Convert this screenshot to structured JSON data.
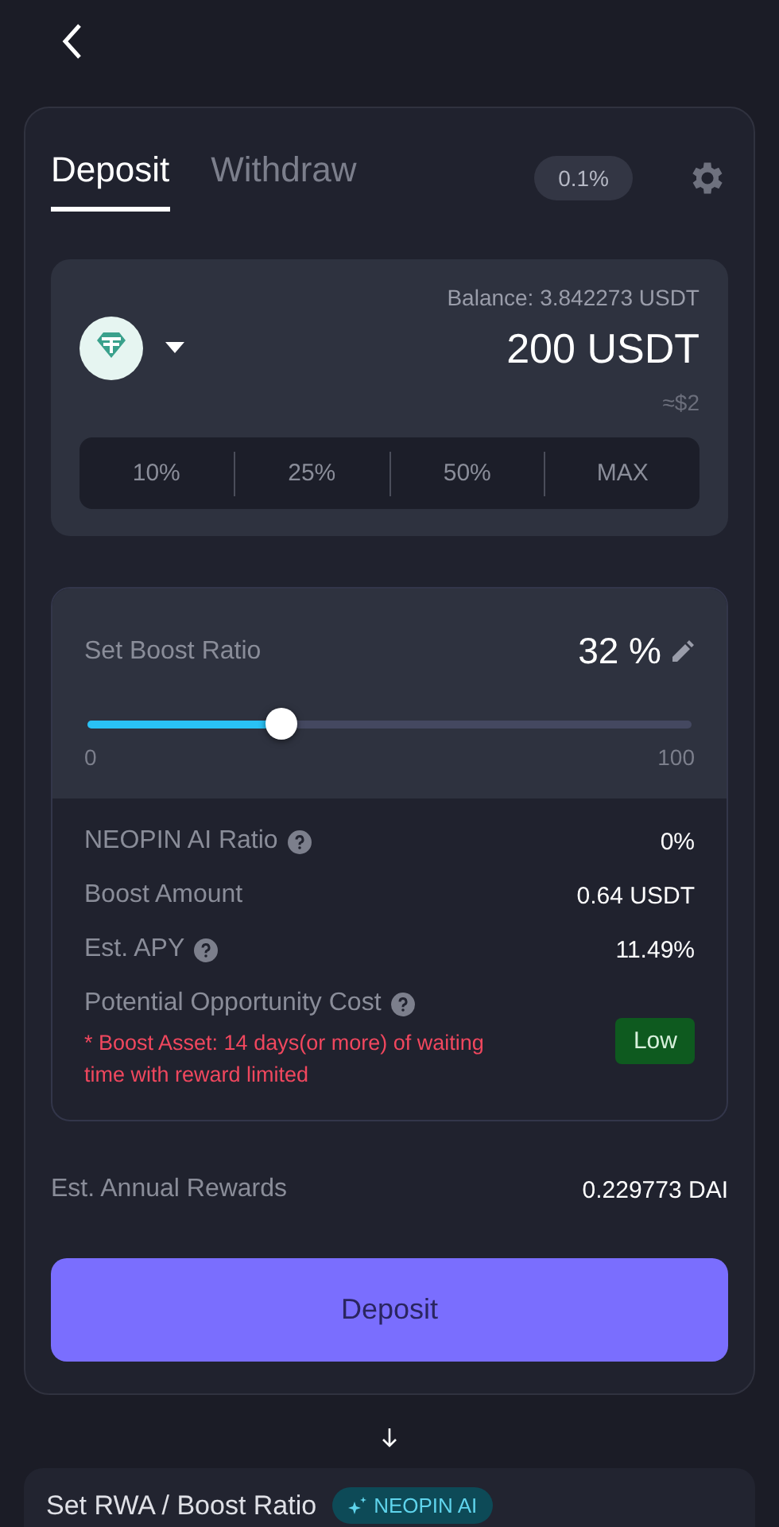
{
  "tabs": [
    {
      "label": "Deposit",
      "selected": true
    },
    {
      "label": "Withdraw",
      "selected": false
    }
  ],
  "slippage": "0.1%",
  "token": {
    "balance_label": "Balance:",
    "balance": "3.842273 USDT",
    "amount": "200",
    "unit": "USDT",
    "usd": "≈$2"
  },
  "percent_buttons": [
    "10%",
    "25%",
    "50%",
    "MAX"
  ],
  "boost": {
    "label": "Set Boost Ratio",
    "value": "32 %",
    "level": 0.32,
    "min": "0",
    "max": "100"
  },
  "details": [
    {
      "label": "NEOPIN AI Ratio",
      "help": true,
      "value": "0%"
    },
    {
      "label": "Boost Amount",
      "help": false,
      "value": "0.64 USDT"
    },
    {
      "label": "Est. APY",
      "help": true,
      "value": "11.49%"
    }
  ],
  "opportunity": {
    "label": "Potential Opportunity Cost",
    "help": true,
    "warning": "* Boost Asset: 14 days(or more) of waiting time with reward limited",
    "level_label": "Low"
  },
  "annual": {
    "label": "Est. Annual Rewards",
    "value": "0.229773 DAI"
  },
  "deposit_button": "Deposit",
  "next_card": {
    "title": "Set RWA / Boost Ratio",
    "badge": "NEOPIN AI"
  }
}
